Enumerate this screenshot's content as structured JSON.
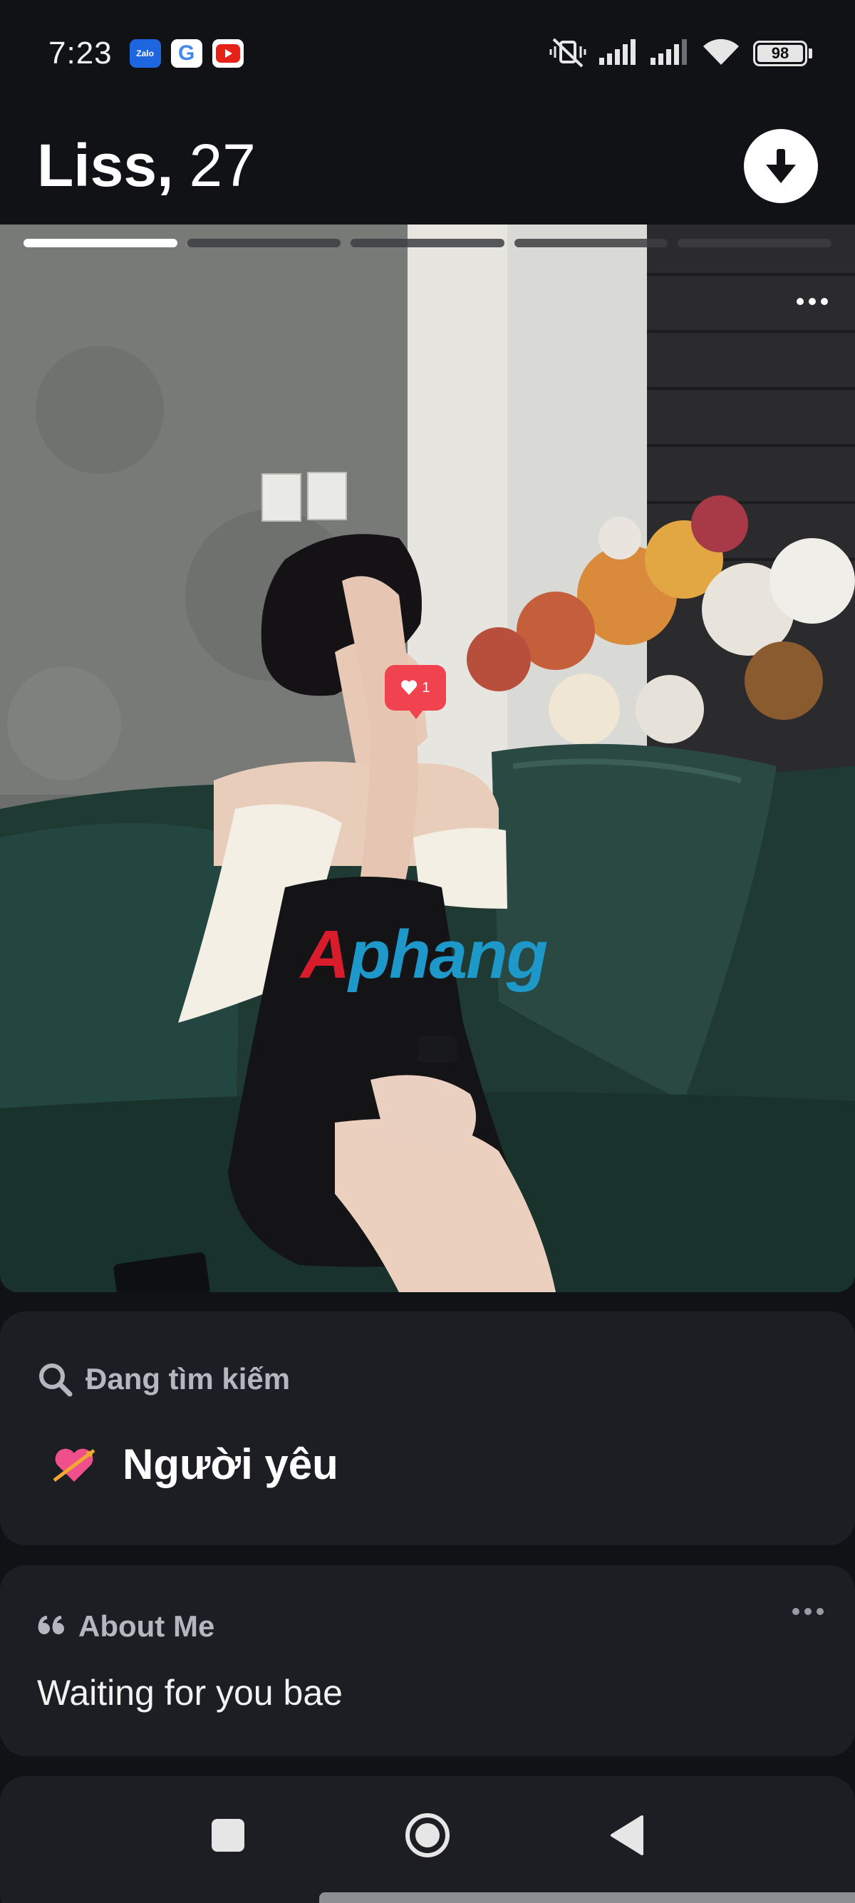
{
  "status_bar": {
    "time": "7:23",
    "apps": [
      {
        "name": "zalo",
        "label": "Zalo"
      },
      {
        "name": "google",
        "label": "G"
      },
      {
        "name": "youtube",
        "label": ""
      }
    ],
    "battery": "98",
    "icons": [
      "mute-vibrate-icon",
      "signal-icon",
      "signal-icon",
      "wifi-icon",
      "battery-icon"
    ]
  },
  "profile": {
    "name": "Liss",
    "comma": ",",
    "age": "27",
    "download_icon": "arrow-down-icon"
  },
  "photo": {
    "progress_total": 5,
    "progress_active": 1,
    "like_count": "1",
    "watermark_first": "A",
    "watermark_rest": "phang"
  },
  "looking_for": {
    "heading": "Đang tìm kiếm",
    "heading_icon": "search-icon",
    "value": "Người yêu",
    "value_icon": "heart-arrow-emoji"
  },
  "about": {
    "heading": "About Me",
    "heading_icon": "quote-icon",
    "text": "Waiting for you bae"
  },
  "nav": {
    "buttons": [
      "recents-square-icon",
      "home-circle-icon",
      "back-triangle-icon"
    ]
  },
  "colors": {
    "background": "#111216",
    "card": "#1d1e23",
    "like_badge": "#f0424f",
    "watermark_red": "#d81c2c",
    "watermark_blue": "#1d98c9"
  }
}
